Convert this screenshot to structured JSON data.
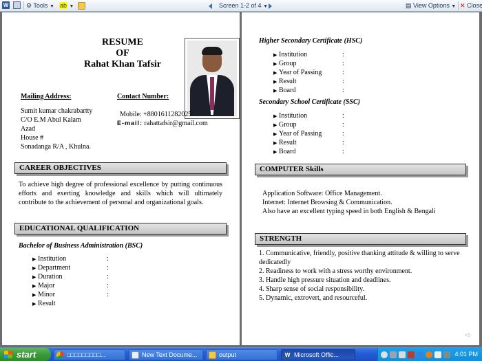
{
  "toolbar": {
    "tools_label": "Tools",
    "screen_label": "Screen 1-2 of 4",
    "view_options_label": "View Options",
    "close_label": "Close",
    "highlight_label": "ab"
  },
  "resume": {
    "title_line1": "RESUME",
    "title_line2": "OF",
    "name": "Rahat Khan Tafsir",
    "mailing_label": "Mailing Address:",
    "mailing_lines": [
      "Sumit kumar chakrabartty",
      "C/O E.M Abul Kalam",
      "Azad",
      "House #",
      "Sonadanga R/A , Khulna."
    ],
    "contact_label": "Contact Number:",
    "mobile": "Mobile: +8801611282025",
    "email_label": "E-mail:",
    "email": "rahattafsir@gmail.com",
    "career_heading": "CAREER OBJECTIVES",
    "career_text": "To achieve high degree of professional excellence by putting continuous efforts and exerting knowledge and skills which will ultimately contribute to the achievement of personal and organizational goals.",
    "edu_heading": "EDUCATIONAL QUALIFICATION",
    "bsc_heading": "Bachelor of Business Administration (BSC)",
    "bsc_fields": [
      "Institution",
      "Department",
      "Duration",
      "Major",
      "Minor",
      "Result"
    ],
    "hsc_heading": "Higher Secondary Certificate (HSC)",
    "hsc_fields": [
      "Institution",
      "Group",
      "Year of Passing",
      "Result",
      "Board"
    ],
    "ssc_heading": "Secondary School Certificate (SSC)",
    "ssc_fields": [
      "Institution",
      "Group",
      "Year of Passing",
      "Result",
      "Board"
    ],
    "computer_heading": "COMPUTER  Skills",
    "computer_lines": [
      "Application Software: Office Management.",
      "Internet: Internet Browsing & Communication.",
      "Also have an excellent typing speed in both English & Bengali"
    ],
    "strength_heading": "STRENGTH",
    "strength_lines": [
      "1. Communicative, friendly, positive thanking attitude & willing to serve dedicatedly",
      "2. Readiness to work with a stress worthy environment.",
      "3. Handle high pressure situation and deadlines.",
      "4. Sharp sense of social responsibility.",
      "5. Dynamic, extrovert, and resourceful."
    ],
    "colon": ":",
    "bullet": "▶"
  },
  "taskbar": {
    "start_label": "start",
    "buttons": [
      "□□□□□□□□□...",
      "New Text Docume...",
      "output",
      "Microsoft Offic..."
    ],
    "clock": "4:01 PM"
  }
}
